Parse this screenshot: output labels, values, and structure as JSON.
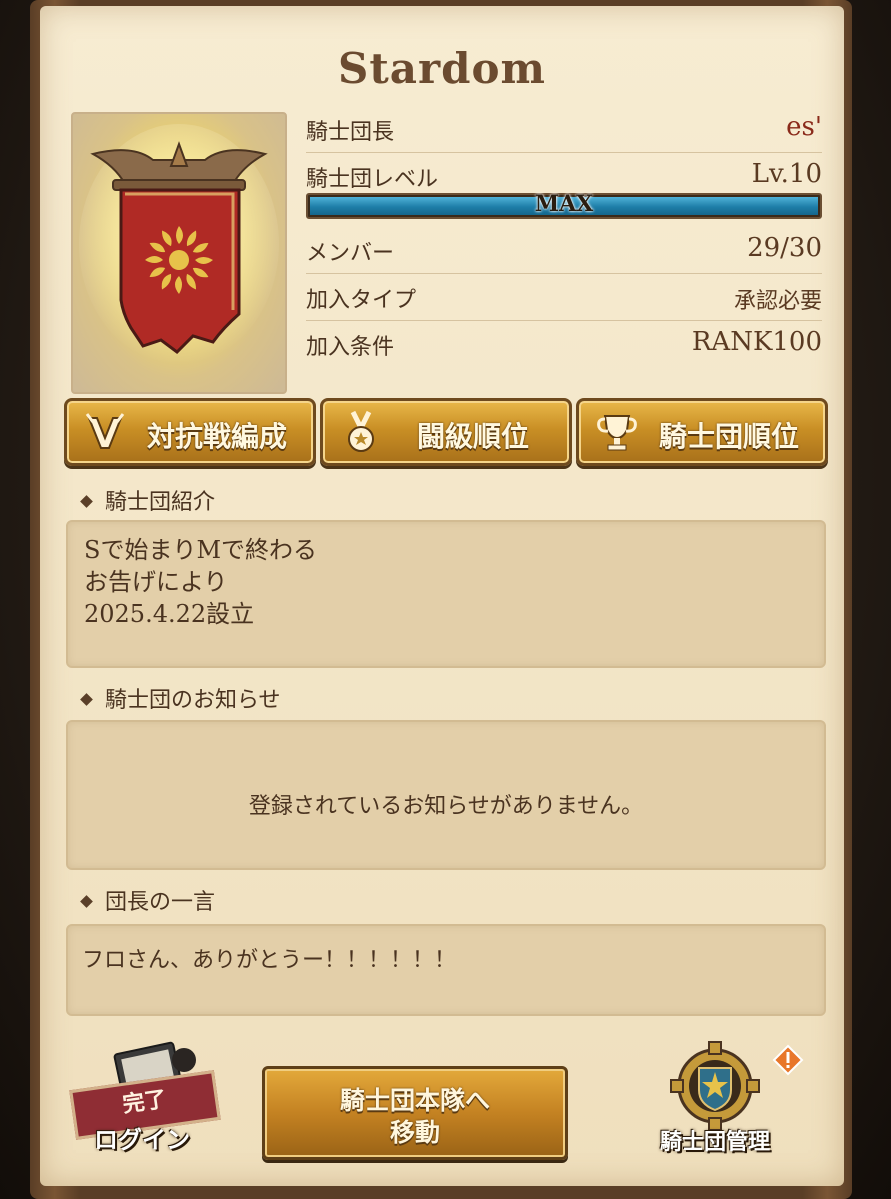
{
  "guild": {
    "name": "Stardom",
    "info": [
      {
        "key": "騎士団長",
        "value": "es'"
      },
      {
        "key": "騎士団レベル",
        "value": "Lv.10"
      },
      {
        "key": "メンバー",
        "value": "29/30"
      },
      {
        "key": "加入タイプ",
        "value": "承認必要"
      },
      {
        "key": "加入条件",
        "value": "RANK100"
      }
    ],
    "level_bar": {
      "label": "MAX",
      "fill_fraction": 1.0
    }
  },
  "buttons": {
    "versus": "対抗戦編成",
    "battle_rank": "闘級順位",
    "guild_rank": "騎士団順位"
  },
  "sections": {
    "intro_title": "騎士団紹介",
    "intro_lines": [
      "Sで始まりMで終わる",
      "お告げにより",
      "2025.4.22設立"
    ],
    "notice_title": "騎士団のお知らせ",
    "notice_empty": "登録されているお知らせがありません。",
    "leader_title": "団長の一言",
    "leader_comment": "フロさん、ありがとうー！！！！！！"
  },
  "bottom": {
    "login_done": "完了",
    "login": "ログイン",
    "move_line1": "騎士団本隊へ",
    "move_line2": "移動",
    "manage": "騎士団管理"
  },
  "icons": [
    "banner-emblem-icon",
    "vs-icon",
    "medal-icon",
    "trophy-icon",
    "book-icon",
    "gear-shield-icon",
    "alert-icon"
  ],
  "colors": {
    "accent_gold": "#c98f25",
    "bar_blue": "#1e7ea8",
    "banner_red": "#b02a25",
    "done_red": "#8f2d34"
  }
}
